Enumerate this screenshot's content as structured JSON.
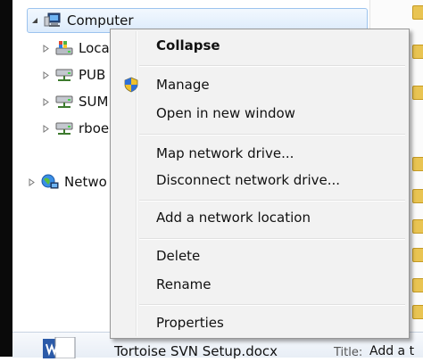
{
  "tree": [
    {
      "id": "computer",
      "label": "Computer",
      "icon": "computer-icon",
      "expanded": true,
      "selected": true
    },
    {
      "id": "local",
      "label": "Loca",
      "icon": "local-disk-icon"
    },
    {
      "id": "pub",
      "label": "PUB",
      "icon": "network-drive-icon"
    },
    {
      "id": "sum",
      "label": "SUM",
      "icon": "network-drive-icon"
    },
    {
      "id": "rboe",
      "label": "rboe",
      "icon": "network-drive-icon"
    },
    {
      "id": "network",
      "label": "Netwo",
      "icon": "network-globe-icon"
    }
  ],
  "bottom": {
    "file_name": "Tortoise SVN Setup.docx",
    "title_key": "Title:",
    "title_value": "Add a t"
  },
  "context_menu": {
    "items": [
      {
        "label": "Collapse",
        "bold": true
      },
      {
        "label": "Manage",
        "icon": "uac-shield-icon"
      },
      {
        "label": "Open in new window"
      },
      {
        "label": "Map network drive..."
      },
      {
        "label": "Disconnect network drive..."
      },
      {
        "label": "Add a network location"
      },
      {
        "label": "Delete"
      },
      {
        "label": "Rename"
      },
      {
        "label": "Properties"
      }
    ]
  },
  "colors": {
    "selection_border": "#9cc3ee",
    "menu_background": "#f2f2f2",
    "menu_border": "#979797"
  }
}
